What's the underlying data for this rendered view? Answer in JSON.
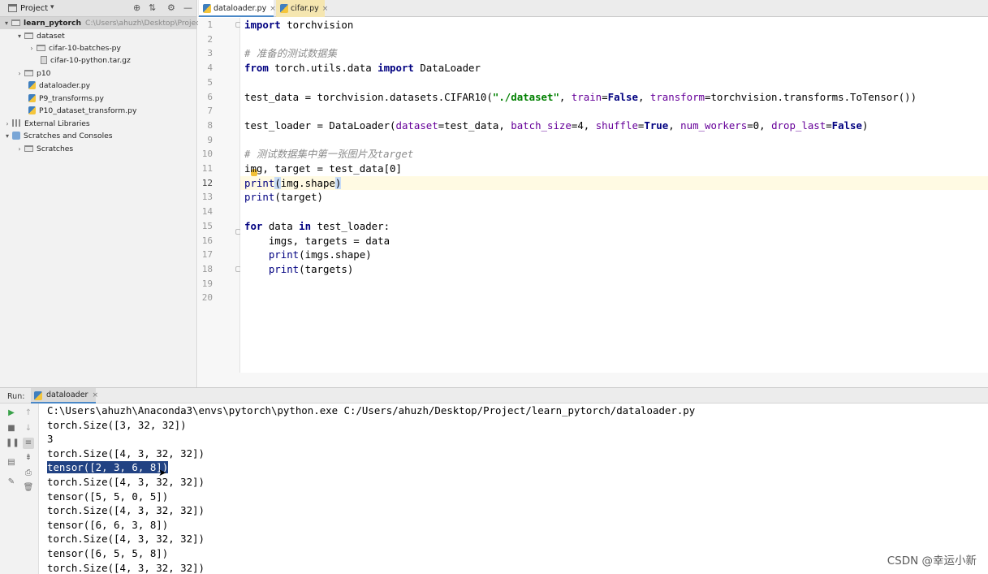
{
  "project_panel": {
    "title": "Project",
    "tree": [
      {
        "label": "learn_pytorch",
        "path": "C:\\Users\\ahuzh\\Desktop\\Project\\le"
      },
      {
        "label": "dataset"
      },
      {
        "label": "cifar-10-batches-py"
      },
      {
        "label": "cifar-10-python.tar.gz"
      },
      {
        "label": "p10"
      },
      {
        "label": "dataloader.py"
      },
      {
        "label": "P9_transforms.py"
      },
      {
        "label": "P10_dataset_transform.py"
      },
      {
        "label": "External Libraries"
      },
      {
        "label": "Scratches and Consoles"
      },
      {
        "label": "Scratches"
      }
    ]
  },
  "editor": {
    "tabs": [
      {
        "label": "dataloader.py",
        "active": true
      },
      {
        "label": "cifar.py",
        "active": false
      }
    ],
    "line_numbers": [
      "1",
      "2",
      "3",
      "4",
      "5",
      "6",
      "7",
      "8",
      "9",
      "10",
      "11",
      "12",
      "13",
      "14",
      "15",
      "16",
      "17",
      "18",
      "19",
      "20"
    ],
    "current_line": "12",
    "code": {
      "l1": {
        "kw": "import",
        "rest": " torchvision"
      },
      "l3": {
        "comment": "# 准备的测试数据集"
      },
      "l4": {
        "kw1": "from",
        "mod": " torch.utils.data ",
        "kw2": "import",
        "rest": " DataLoader"
      },
      "l6": {
        "a": "test_data = torchvision.datasets.CIFAR10(",
        "s": "\"./dataset\"",
        "c1": ", ",
        "p1": "train",
        "eq1": "=",
        "k1": "False",
        "c2": ", ",
        "p2": "transform",
        "b": "=torchvision.transforms.ToTensor())"
      },
      "l8": {
        "a": "test_loader = DataLoader(",
        "p1": "dataset",
        "v1": "=test_data, ",
        "p2": "batch_size",
        "v2": "=4, ",
        "p3": "shuffle",
        "eq3": "=",
        "k3": "True",
        "c3": ", ",
        "p4": "num_workers",
        "v4": "=0, ",
        "p5": "drop_last",
        "eq5": "=",
        "k5": "False",
        "end": ")"
      },
      "l10": {
        "comment": "# 测试数据集中第一张图片及target"
      },
      "l11": {
        "text": "img, target = test_data[0]"
      },
      "l12": {
        "fn": "print",
        "open": "(",
        "mid": "img.shape",
        "close": ")"
      },
      "l13": {
        "fn": "print",
        "rest": "(target)"
      },
      "l15": {
        "kw1": "for",
        "mid": " data ",
        "kw2": "in",
        "rest": " test_loader:"
      },
      "l16": {
        "text": "    imgs, targets = data"
      },
      "l17": {
        "indent": "    ",
        "fn": "print",
        "rest": "(imgs.shape)"
      },
      "l18": {
        "indent": "    ",
        "fn": "print",
        "rest": "(targets)"
      }
    }
  },
  "run_panel": {
    "label": "Run:",
    "tab": "dataloader",
    "output": [
      "C:\\Users\\ahuzh\\Anaconda3\\envs\\pytorch\\python.exe C:/Users/ahuzh/Desktop/Project/learn_pytorch/dataloader.py",
      "torch.Size([3, 32, 32])",
      "3",
      "torch.Size([4, 3, 32, 32])",
      "tensor([2, 3, 6, 8])",
      "torch.Size([4, 3, 32, 32])",
      "tensor([5, 5, 0, 5])",
      "torch.Size([4, 3, 32, 32])",
      "tensor([6, 6, 3, 8])",
      "torch.Size([4, 3, 32, 32])",
      "tensor([6, 5, 5, 8])",
      "torch.Size([4, 3, 32, 32])"
    ],
    "selected_line": "tensor([2, 3, 6, 8])"
  },
  "watermark": "CSDN @幸运小新",
  "colors": {
    "keyword": "#000080",
    "string": "#008000",
    "comment": "#8c8c8c",
    "param": "#660099",
    "selection": "#214283",
    "current_line": "#fffae3"
  }
}
